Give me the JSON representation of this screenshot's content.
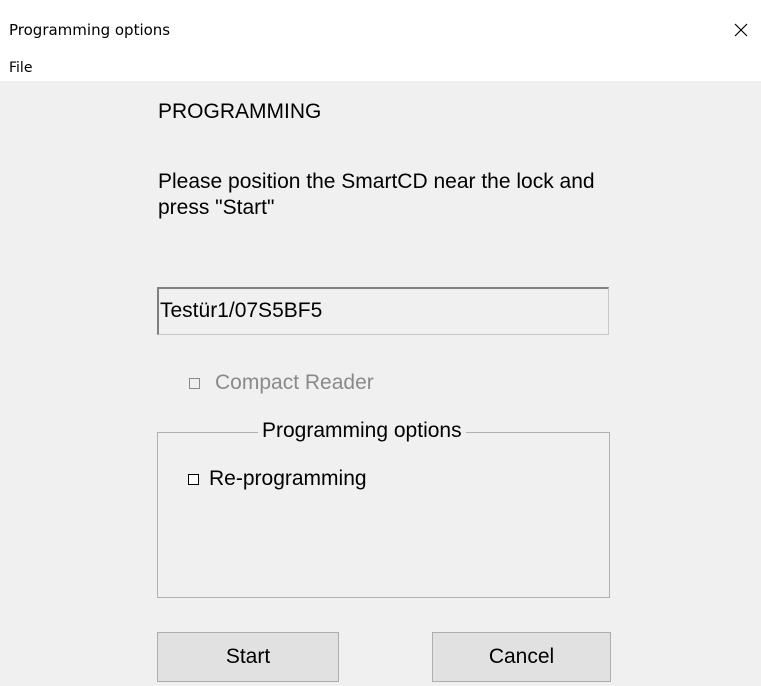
{
  "window": {
    "title": "Programming options",
    "close_icon": "close-icon"
  },
  "menu": {
    "items": [
      "File"
    ]
  },
  "main": {
    "heading": "PROGRAMMING",
    "instruction": "Please position the SmartCD near the lock and press \"Start\"",
    "key_field_value": "Testür1/07S5BF5",
    "compact_reader": {
      "label": "Compact Reader",
      "checked": false,
      "disabled": true
    },
    "options_group": {
      "title": "Programming options",
      "reprogramming": {
        "label": "Re-programming",
        "checked": false
      }
    },
    "buttons": {
      "start": "Start",
      "cancel": "Cancel"
    }
  }
}
